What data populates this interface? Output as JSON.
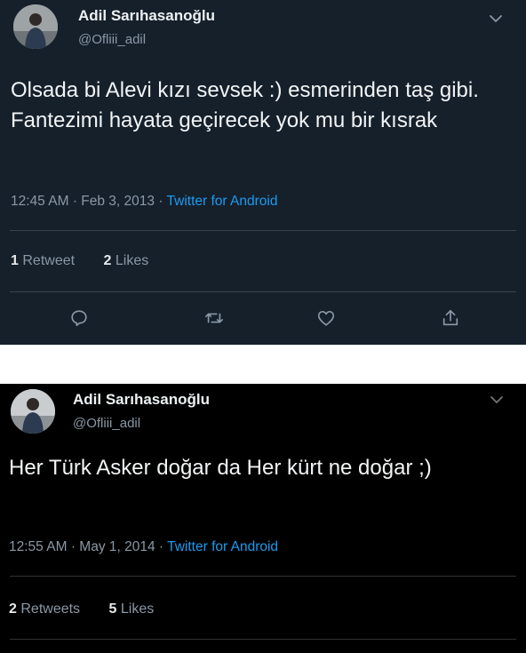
{
  "tweets": [
    {
      "author_name": "Adil Sarıhasanoğlu",
      "author_handle": "@Ofliii_adil",
      "text": "Olsada bi Alevi kızı sevsek :) esmerinden taş gibi. Fantezimi hayata geçirecek yok mu bir kısrak",
      "time": "12:45 AM",
      "date": "Feb 3, 2013",
      "source": "Twitter for Android",
      "retweet_count": "1",
      "retweet_label": "Retweet",
      "like_count": "2",
      "like_label": "Likes"
    },
    {
      "author_name": "Adil Sarıhasanoğlu",
      "author_handle": "@Ofliii_adil",
      "text": "Her Türk Asker doğar da Her kürt ne doğar ;)",
      "time": "12:55 AM",
      "date": "May 1, 2014",
      "source": "Twitter for Android",
      "retweet_count": "2",
      "retweet_label": "Retweets",
      "like_count": "5",
      "like_label": "Likes"
    }
  ],
  "separator": "·",
  "icons": {
    "reply": "reply-icon",
    "retweet": "retweet-icon",
    "like": "like-icon",
    "share": "share-icon",
    "more": "chevron-down-icon"
  },
  "colors": {
    "dim_background": "#15202b",
    "black_background": "#000000",
    "link": "#1d9bf0",
    "secondary_text": "#8b98a5"
  }
}
